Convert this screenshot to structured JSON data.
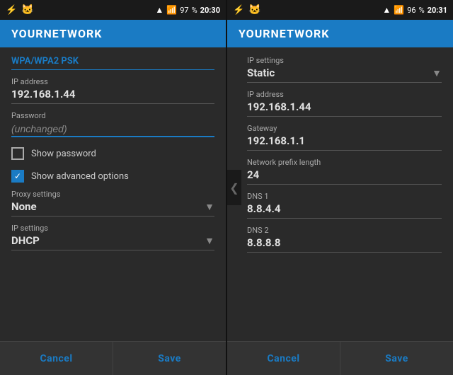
{
  "left_screen": {
    "status": {
      "time": "20:30",
      "battery": "97",
      "battery_symbol": "🔋"
    },
    "title": "YOURNETWORK",
    "section": "WPA/WPA2 PSK",
    "ip_label": "IP address",
    "ip_value": "192.168.1.44",
    "password_label": "Password",
    "password_placeholder": "(unchanged)",
    "show_password_label": "Show password",
    "show_advanced_label": "Show advanced options",
    "show_advanced_checked": true,
    "proxy_label": "Proxy settings",
    "proxy_value": "None",
    "ip_settings_label": "IP settings",
    "ip_settings_value": "DHCP",
    "cancel_label": "Cancel",
    "save_label": "Save"
  },
  "right_screen": {
    "status": {
      "time": "20:31",
      "battery": "96"
    },
    "title": "YOURNETWORK",
    "ip_settings_label": "IP settings",
    "ip_settings_value": "Static",
    "ip_label": "IP address",
    "ip_value": "192.168.1.44",
    "gateway_label": "Gateway",
    "gateway_value": "192.168.1.1",
    "prefix_label": "Network prefix length",
    "prefix_value": "24",
    "dns1_label": "DNS 1",
    "dns1_value": "8.8.4.4",
    "dns2_label": "DNS 2",
    "dns2_value": "8.8.8.8",
    "cancel_label": "Cancel",
    "save_label": "Save"
  },
  "icons": {
    "cat": "🐱",
    "wifi": "📶",
    "arrow_down": "▼",
    "arrow_left": "❮",
    "check": "✓"
  }
}
